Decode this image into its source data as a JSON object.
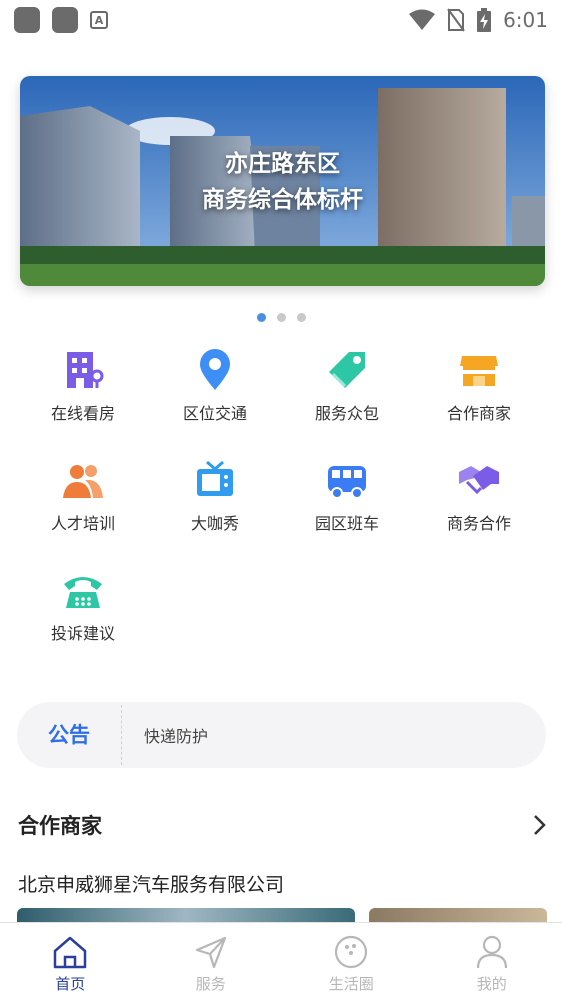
{
  "status_bar": {
    "time": "6:01",
    "icons": [
      "app-square-icon",
      "app-square-icon",
      "a-badge-icon",
      "wifi-icon",
      "no-sim-icon",
      "battery-charging-icon"
    ]
  },
  "banner": {
    "line1": "亦庄路东区",
    "line2": "商务综合体标杆",
    "pages": 3,
    "active_page": 1
  },
  "services": [
    {
      "label": "在线看房",
      "icon": "building-icon",
      "color": "#7b5ce6"
    },
    {
      "label": "区位交通",
      "icon": "location-pin-icon",
      "color": "#3e8ff5"
    },
    {
      "label": "服务众包",
      "icon": "tag-icon",
      "color": "#2ec7a6"
    },
    {
      "label": "合作商家",
      "icon": "storefront-icon",
      "color": "#f5a623"
    },
    {
      "label": "人才培训",
      "icon": "people-icon",
      "color": "#f07c3c"
    },
    {
      "label": "大咖秀",
      "icon": "tv-icon",
      "color": "#2f9cf0"
    },
    {
      "label": "园区班车",
      "icon": "bus-icon",
      "color": "#3c7cf2"
    },
    {
      "label": "商务合作",
      "icon": "handshake-icon",
      "color": "#7b5ce6"
    },
    {
      "label": "投诉建议",
      "icon": "phone-icon",
      "color": "#2ec7a6"
    }
  ],
  "notice": {
    "tag": "公告",
    "text": "快递防护"
  },
  "partners": {
    "title": "合作商家",
    "company": "北京申威狮星汽车服务有限公司"
  },
  "tabbar": [
    {
      "label": "首页",
      "icon": "home-icon",
      "active": true
    },
    {
      "label": "服务",
      "icon": "send-icon",
      "active": false
    },
    {
      "label": "生活圈",
      "icon": "bowling-ball-icon",
      "active": false
    },
    {
      "label": "我的",
      "icon": "user-icon",
      "active": false
    }
  ]
}
